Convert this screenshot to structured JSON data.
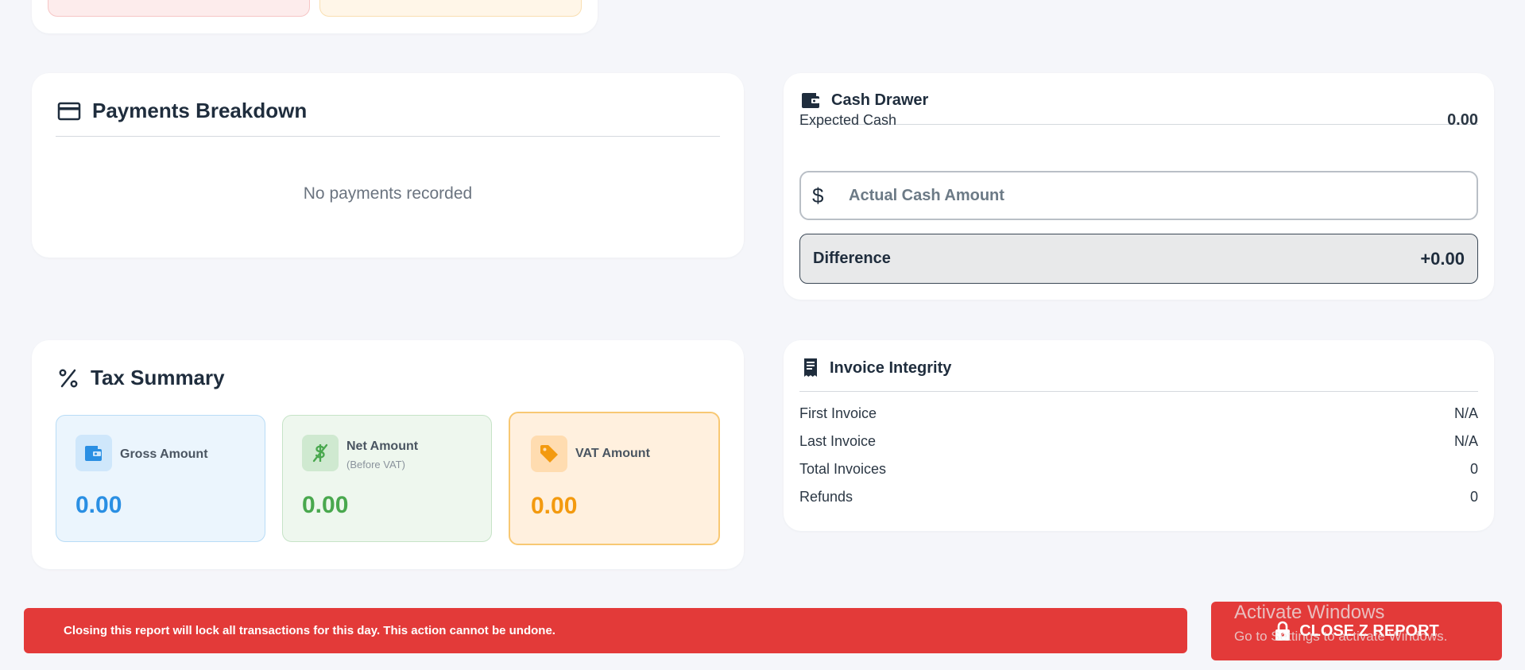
{
  "payments": {
    "title": "Payments Breakdown",
    "empty_message": "No payments recorded"
  },
  "cash_drawer": {
    "title": "Cash Drawer",
    "expected_label": "Expected Cash",
    "expected_value": "0.00",
    "actual_placeholder": "Actual Cash Amount",
    "currency_symbol": "$",
    "difference_label": "Difference",
    "difference_value": "+0.00"
  },
  "tax_summary": {
    "title": "Tax Summary",
    "gross": {
      "label": "Gross Amount",
      "value": "0.00",
      "icon": "wallet-icon",
      "color": "#2a8fe3"
    },
    "net": {
      "label": "Net Amount",
      "sublabel": "(Before VAT)",
      "value": "0.00",
      "icon": "dollar-strike-icon",
      "color": "#49a84e"
    },
    "vat": {
      "label": "VAT Amount",
      "value": "0.00",
      "icon": "tag-icon",
      "color": "#f39a0f"
    }
  },
  "invoice_integrity": {
    "title": "Invoice Integrity",
    "rows": [
      {
        "label": "First Invoice",
        "value": "N/A"
      },
      {
        "label": "Last Invoice",
        "value": "N/A"
      },
      {
        "label": "Total Invoices",
        "value": "0"
      },
      {
        "label": "Refunds",
        "value": "0"
      }
    ]
  },
  "footer": {
    "warning": "Closing this report will lock all transactions for this day. This action cannot be undone.",
    "close_button": "CLOSE Z REPORT",
    "accent_color": "#e33a39"
  },
  "watermark": {
    "line1": "Activate Windows",
    "line2": "Go to Settings to activate Windows."
  }
}
